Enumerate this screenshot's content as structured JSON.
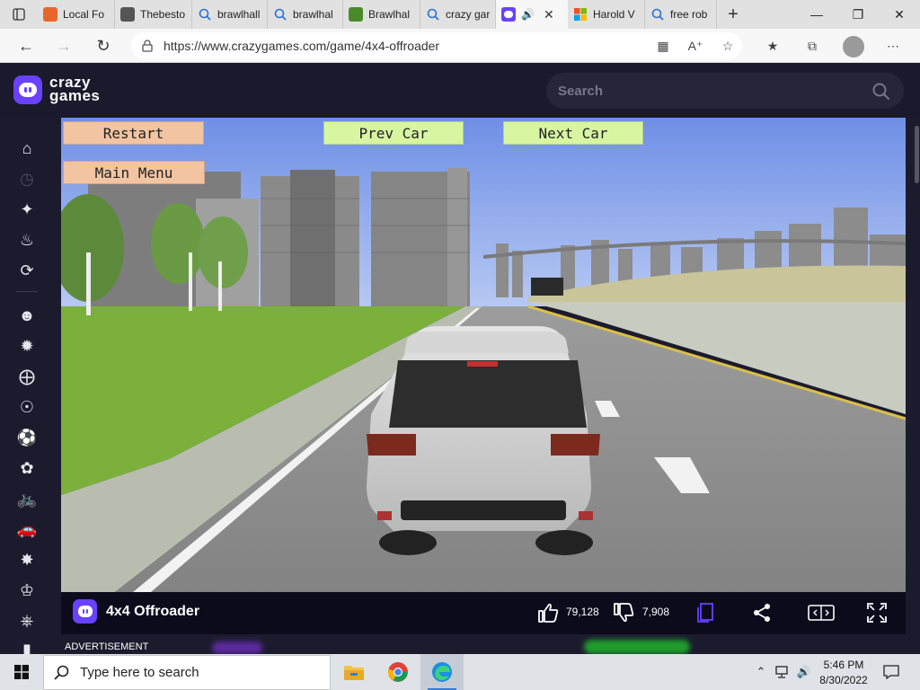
{
  "browser": {
    "tabs": [
      {
        "title": "Local Fo",
        "favicon": "firefox-like-icon",
        "color": "#e8662c"
      },
      {
        "title": "Thebesto",
        "favicon": "roblox-icon",
        "color": "#555555"
      },
      {
        "title": "brawlhall",
        "favicon": "search-icon",
        "color": "#2a6fd8"
      },
      {
        "title": "brawlhal",
        "favicon": "search-icon",
        "color": "#2a6fd8"
      },
      {
        "title": "Brawlhal",
        "favicon": "game-icon",
        "color": "#4a8a2a"
      },
      {
        "title": "crazy gar",
        "favicon": "search-icon",
        "color": "#2a6fd8"
      },
      {
        "title": "",
        "favicon": "crazygames-icon",
        "color": "#6842ff",
        "active": true
      },
      {
        "title": "Harold V",
        "favicon": "microsoft-icon",
        "color": "#f25022"
      },
      {
        "title": "free rob",
        "favicon": "search-icon",
        "color": "#2a6fd8"
      }
    ],
    "url": "https://www.crazygames.com/game/4x4-offroader"
  },
  "site": {
    "logo_line1": "crazy",
    "logo_line2": "games",
    "search_placeholder": "Search",
    "brand_color": "#6842ff"
  },
  "sidebar": {
    "items": [
      "home-icon",
      "recent-icon",
      "new-icon",
      "trending-icon",
      "updated-icon",
      "multiplayer-icon",
      "action-icon",
      "adventure-icon",
      "arcade-icon",
      "sports-icon",
      "casual-icon",
      "bike-icon",
      "car-icon",
      "clicker-icon",
      "io-icon",
      "driving-icon",
      "more-icon"
    ]
  },
  "game": {
    "buttons": {
      "restart": "Restart",
      "main_menu": "Main Menu",
      "prev_car": "Prev Car",
      "next_car": "Next Car"
    },
    "title": "4x4 Offroader",
    "likes": "79,128",
    "dislikes": "7,908",
    "ad_label": "ADVERTISEMENT"
  },
  "taskbar": {
    "search_placeholder": "Type here to search",
    "time": "5:46 PM",
    "date": "8/30/2022"
  }
}
